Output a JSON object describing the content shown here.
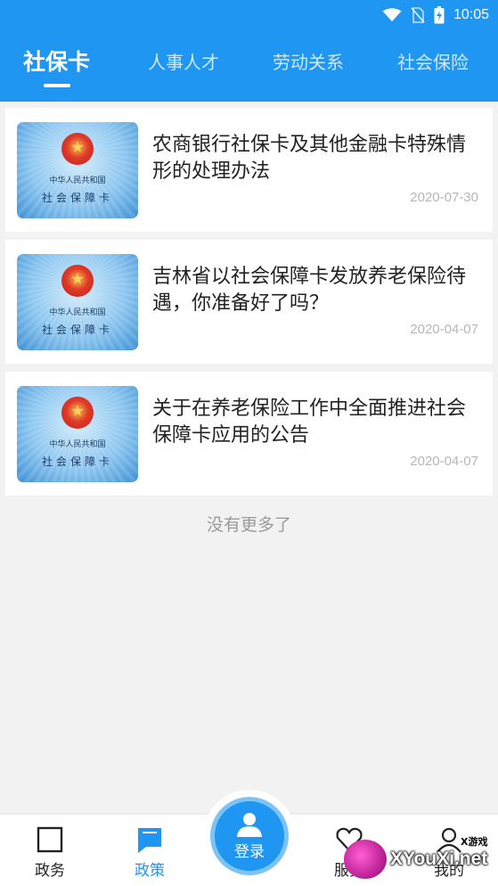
{
  "status_bar": {
    "time": "10:05"
  },
  "tabs": [
    {
      "label": "社保卡",
      "active": true
    },
    {
      "label": "人事人才",
      "active": false
    },
    {
      "label": "劳动关系",
      "active": false
    },
    {
      "label": "社会保险",
      "active": false
    }
  ],
  "articles": [
    {
      "title": "农商银行社保卡及其他金融卡特殊情形的处理办法",
      "date": "2020-07-30",
      "thumb_line1": "中华人民共和国",
      "thumb_line2": "社会保障卡"
    },
    {
      "title": "吉林省以社会保障卡发放养老保险待遇，你准备好了吗？",
      "date": "2020-04-07",
      "thumb_line1": "中华人民共和国",
      "thumb_line2": "社会保障卡"
    },
    {
      "title": "关于在养老保险工作中全面推进社会保障卡应用的公告",
      "date": "2020-04-07",
      "thumb_line1": "中华人民共和国",
      "thumb_line2": "社会保障卡"
    }
  ],
  "no_more_text": "没有更多了",
  "bottom_nav": {
    "items": [
      {
        "label": "政务",
        "icon": "square-icon",
        "active": false
      },
      {
        "label": "政策",
        "icon": "chat-icon",
        "active": true
      },
      {
        "label": "服务",
        "icon": "heart-icon",
        "active": false
      },
      {
        "label": "我的",
        "icon": "user-icon",
        "active": false
      }
    ],
    "center": {
      "label": "登录",
      "icon": "user-icon"
    }
  },
  "watermark": {
    "text": "XYouXi.net",
    "small": "X游戏"
  },
  "colors": {
    "primary": "#1e96f2",
    "date": "#b6b6b6",
    "background": "#f2f2f2"
  }
}
